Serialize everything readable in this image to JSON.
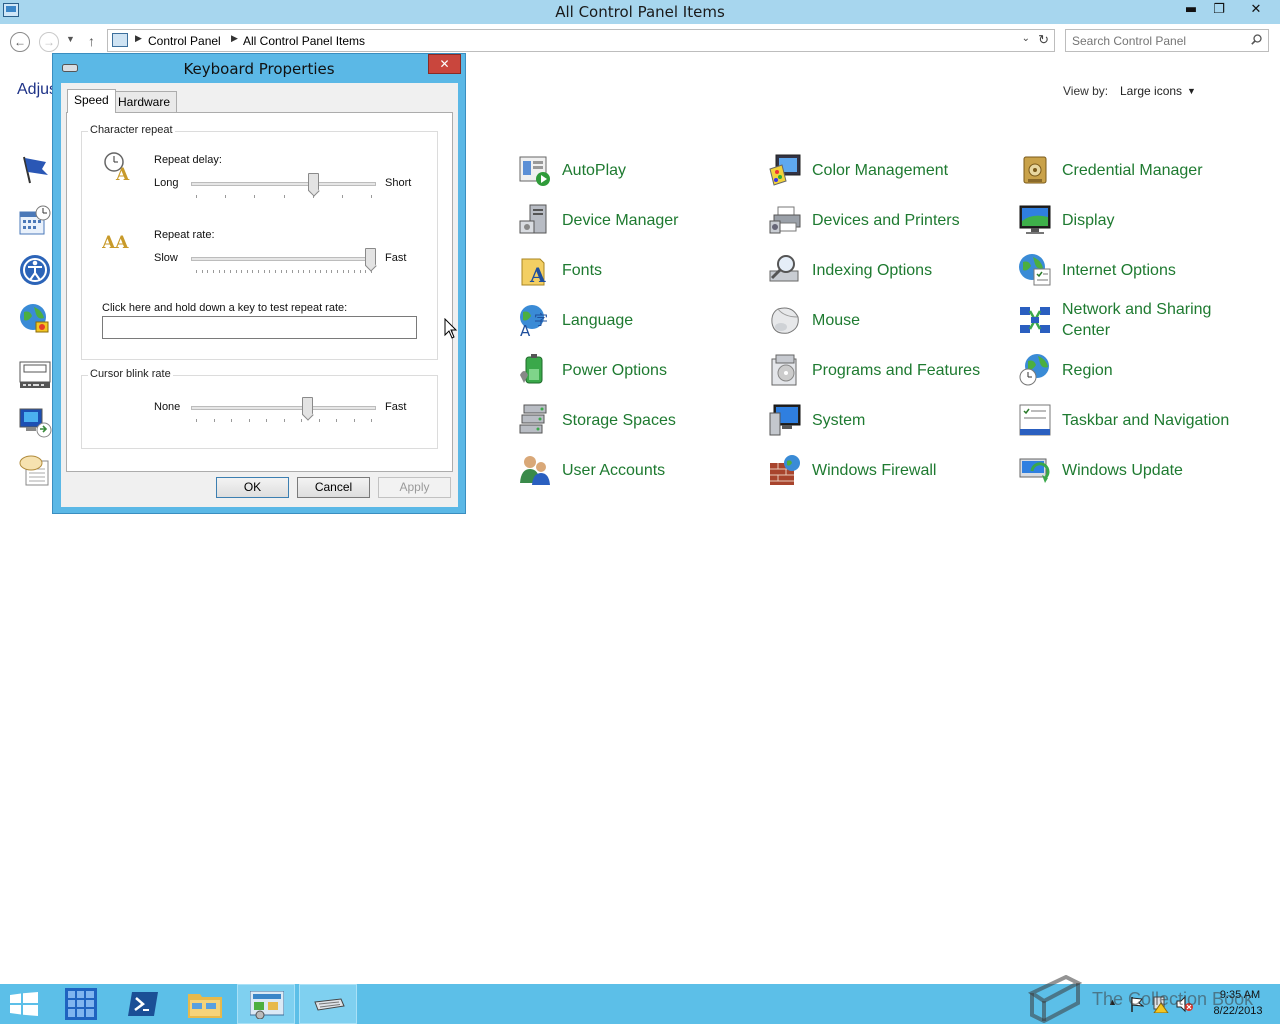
{
  "window": {
    "title": "All Control Panel Items"
  },
  "titlebar_buttons": {
    "minimize": "▬",
    "maximize": "❐",
    "close": "✕"
  },
  "address": {
    "breadcrumb": [
      "Control Panel",
      "All Control Panel Items"
    ],
    "search_placeholder": "Search Control Panel"
  },
  "page": {
    "heading_partial": "Adjus",
    "view_by_label": "View by:",
    "view_by_value": "Large icons"
  },
  "left_task_icons": [
    "action-center-icon",
    "date-time-icon",
    "ease-of-access-icon",
    "internet-options-icon",
    "keyboard-icon",
    "remoteapp-icon",
    "speech-icon"
  ],
  "items": [
    {
      "label": "AutoPlay",
      "icon": "autoplay-icon"
    },
    {
      "label": "Color Management",
      "icon": "color-management-icon"
    },
    {
      "label": "Credential Manager",
      "icon": "credential-manager-icon"
    },
    {
      "label": "Device Manager",
      "icon": "device-manager-icon"
    },
    {
      "label": "Devices and Printers",
      "icon": "devices-printers-icon"
    },
    {
      "label": "Display",
      "icon": "display-icon"
    },
    {
      "label": "Fonts",
      "icon": "fonts-icon"
    },
    {
      "label": "Indexing Options",
      "icon": "indexing-icon"
    },
    {
      "label": "Internet Options",
      "icon": "internet-options-icon"
    },
    {
      "label": "Language",
      "icon": "language-icon"
    },
    {
      "label": "Mouse",
      "icon": "mouse-icon"
    },
    {
      "label": "Network and Sharing Center",
      "icon": "network-icon"
    },
    {
      "label": "Power Options",
      "icon": "power-icon"
    },
    {
      "label": "Programs and Features",
      "icon": "programs-icon"
    },
    {
      "label": "Region",
      "icon": "region-icon"
    },
    {
      "label": "Storage Spaces",
      "icon": "storage-icon"
    },
    {
      "label": "System",
      "icon": "system-icon"
    },
    {
      "label": "Taskbar and Navigation",
      "icon": "taskbar-icon"
    },
    {
      "label": "User Accounts",
      "icon": "user-accounts-icon"
    },
    {
      "label": "Windows Firewall",
      "icon": "firewall-icon"
    },
    {
      "label": "Windows Update",
      "icon": "windows-update-icon"
    }
  ],
  "dialog": {
    "title": "Keyboard Properties",
    "close": "✕",
    "tabs": [
      "Speed",
      "Hardware"
    ],
    "character_repeat": {
      "legend": "Character repeat",
      "repeat_delay_label": "Repeat delay:",
      "delay_min_label": "Long",
      "delay_max_label": "Short",
      "delay_value": 0.67,
      "repeat_rate_label": "Repeat rate:",
      "rate_min_label": "Slow",
      "rate_max_label": "Fast",
      "rate_value": 1.0,
      "test_label": "Click here and hold down a key to test repeat rate:",
      "test_value": ""
    },
    "cursor_blink": {
      "legend": "Cursor blink rate",
      "min_label": "None",
      "max_label": "Fast",
      "value": 0.64
    },
    "buttons": {
      "ok": "OK",
      "cancel": "Cancel",
      "apply": "Apply"
    }
  },
  "taskbar": {
    "time": "9:35 AM",
    "date": "8/22/2013",
    "apps": [
      "start-icon",
      "server-manager-tile-icon",
      "powershell-icon",
      "file-explorer-icon",
      "control-panel-icon",
      "keyboard-icon"
    ]
  },
  "watermark": "The Collection Book",
  "colors": {
    "titlebar": "#a7d6ee",
    "dialog_frame": "#5bb8e6",
    "link_green": "#1e7a30",
    "taskbar": "#5cbfe8",
    "close_red": "#c9463d"
  }
}
